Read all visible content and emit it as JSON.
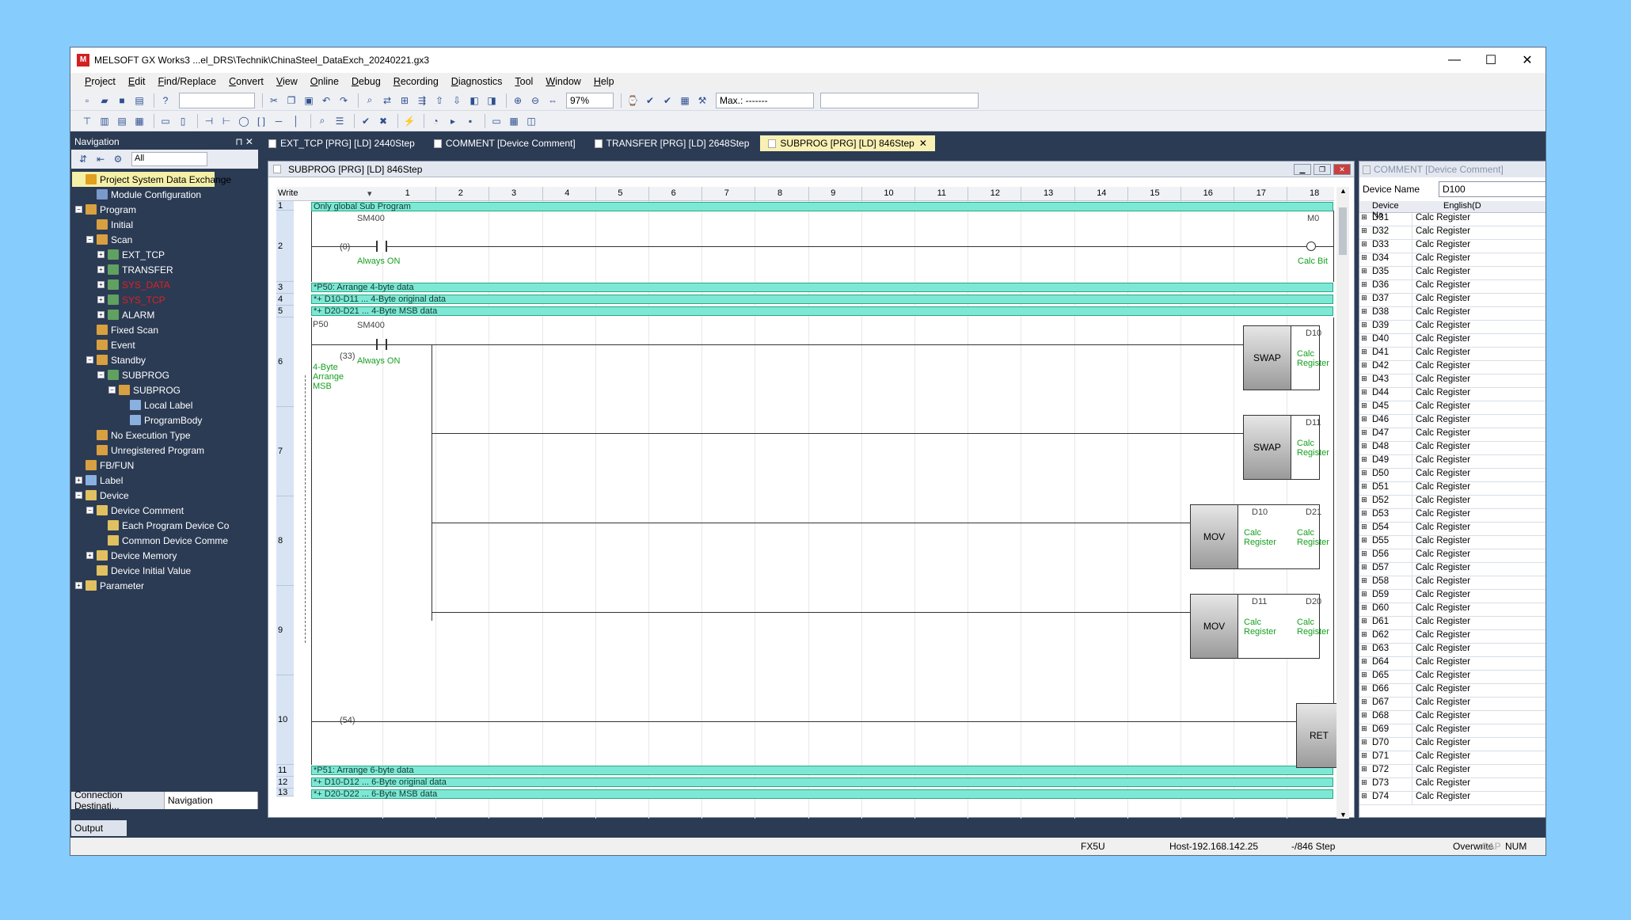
{
  "window": {
    "title": "MELSOFT GX Works3 ...el_DRS\\Technik\\ChinaSteel_DataExch_20240221.gx3",
    "min": "—",
    "max": "☐",
    "close": "✕"
  },
  "menu": [
    "Project",
    "Edit",
    "Find/Replace",
    "Convert",
    "View",
    "Online",
    "Debug",
    "Recording",
    "Diagnostics",
    "Tool",
    "Window",
    "Help"
  ],
  "toolbar": {
    "zoom": "97%",
    "max_label": "Max.: -------"
  },
  "nav": {
    "title": "Navigation",
    "filter": "All",
    "tree": [
      {
        "label": "Project System Data Exchange",
        "level": 0,
        "exp": "",
        "icon": "prj",
        "sel": true
      },
      {
        "label": "Module Configuration",
        "level": 1,
        "exp": "none",
        "icon": "mod"
      },
      {
        "label": "Program",
        "level": 0,
        "exp": "−",
        "icon": "prog"
      },
      {
        "label": "Initial",
        "level": 1,
        "exp": "none",
        "icon": "prog"
      },
      {
        "label": "Scan",
        "level": 1,
        "exp": "−",
        "icon": "prog"
      },
      {
        "label": "EXT_TCP",
        "level": 2,
        "exp": "+",
        "icon": "sheet"
      },
      {
        "label": "TRANSFER",
        "level": 2,
        "exp": "+",
        "icon": "sheet"
      },
      {
        "label": "SYS_DATA",
        "level": 2,
        "exp": "+",
        "icon": "sheet",
        "red": true
      },
      {
        "label": "SYS_TCP",
        "level": 2,
        "exp": "+",
        "icon": "sheet",
        "red": true
      },
      {
        "label": "ALARM",
        "level": 2,
        "exp": "+",
        "icon": "sheet"
      },
      {
        "label": "Fixed Scan",
        "level": 1,
        "exp": "none",
        "icon": "prog"
      },
      {
        "label": "Event",
        "level": 1,
        "exp": "none",
        "icon": "prog"
      },
      {
        "label": "Standby",
        "level": 1,
        "exp": "−",
        "icon": "prog"
      },
      {
        "label": "SUBPROG",
        "level": 2,
        "exp": "−",
        "icon": "sheet"
      },
      {
        "label": "SUBPROG",
        "level": 3,
        "exp": "−",
        "icon": "prog"
      },
      {
        "label": "Local Label",
        "level": 4,
        "exp": "none",
        "icon": "lbl"
      },
      {
        "label": "ProgramBody",
        "level": 4,
        "exp": "none",
        "icon": "lbl"
      },
      {
        "label": "No Execution Type",
        "level": 1,
        "exp": "none",
        "icon": "prog"
      },
      {
        "label": "Unregistered Program",
        "level": 1,
        "exp": "none",
        "icon": "prog"
      },
      {
        "label": "FB/FUN",
        "level": 0,
        "exp": "none",
        "icon": "prog"
      },
      {
        "label": "Label",
        "level": 0,
        "exp": "+",
        "icon": "lbl"
      },
      {
        "label": "Device",
        "level": 0,
        "exp": "−",
        "icon": "dev"
      },
      {
        "label": "Device Comment",
        "level": 1,
        "exp": "−",
        "icon": "dev"
      },
      {
        "label": "Each Program Device Co",
        "level": 2,
        "exp": "none",
        "icon": "dev"
      },
      {
        "label": "Common Device Comme",
        "level": 2,
        "exp": "none",
        "icon": "dev"
      },
      {
        "label": "Device Memory",
        "level": 1,
        "exp": "+",
        "icon": "dev"
      },
      {
        "label": "Device Initial Value",
        "level": 1,
        "exp": "none",
        "icon": "dev"
      },
      {
        "label": "Parameter",
        "level": 0,
        "exp": "+",
        "icon": "dev"
      }
    ],
    "bottom_tabs": [
      "Connection Destinati...",
      "Navigation"
    ]
  },
  "output_label": "Output",
  "tabs": [
    {
      "label": "EXT_TCP [PRG] [LD] 2440Step",
      "active": false
    },
    {
      "label": "COMMENT [Device Comment]",
      "active": false
    },
    {
      "label": "TRANSFER [PRG] [LD] 2648Step",
      "active": false
    },
    {
      "label": "SUBPROG [PRG] [LD] 846Step",
      "active": true,
      "close": "✕"
    }
  ],
  "editor": {
    "title": "SUBPROG [PRG] [LD] 846Step",
    "mode": "Write",
    "cols": [
      "1",
      "2",
      "3",
      "4",
      "5",
      "6",
      "7",
      "8",
      "9",
      "10",
      "11",
      "12",
      "13",
      "14",
      "15",
      "16",
      "17",
      "18"
    ],
    "rows": [
      "1",
      "2",
      "3",
      "4",
      "5",
      "6",
      "7",
      "8",
      "9",
      "10",
      "11",
      "12",
      "13"
    ],
    "comments": [
      "Only global Sub Program",
      "*P50: Arrange 4-byte data",
      "*+ D10-D11 ... 4-Byte original data",
      "*+ D20-D21 ... 4-Byte MSB data",
      "*P51: Arrange 6-byte data",
      "*+ D10-D12 ... 6-Byte original data",
      "*+ D20-D22 ... 6-Byte MSB data"
    ],
    "steps": [
      "(0)",
      "(33)",
      "(54)"
    ],
    "pointer": "P50",
    "pointer_comment": "4-Byte Arrange MSB",
    "sm400": "SM400",
    "always_on": "Always ON",
    "m0": "M0",
    "calc_bit": "Calc Bit",
    "calc_register": "Calc Register",
    "swap": "SWAP",
    "mov": "MOV",
    "ret": "RET",
    "d10": "D10",
    "d11": "D11",
    "d20": "D20",
    "d21": "D21"
  },
  "comment_panel": {
    "title": "COMMENT [Device Comment]",
    "device_name_label": "Device Name",
    "device_name_value": "D100",
    "headers": [
      "Device Na",
      "English(D"
    ],
    "rows": [
      {
        "d": "D31",
        "e": "Calc Register"
      },
      {
        "d": "D32",
        "e": "Calc Register"
      },
      {
        "d": "D33",
        "e": "Calc Register"
      },
      {
        "d": "D34",
        "e": "Calc Register"
      },
      {
        "d": "D35",
        "e": "Calc Register"
      },
      {
        "d": "D36",
        "e": "Calc Register"
      },
      {
        "d": "D37",
        "e": "Calc Register"
      },
      {
        "d": "D38",
        "e": "Calc Register"
      },
      {
        "d": "D39",
        "e": "Calc Register"
      },
      {
        "d": "D40",
        "e": "Calc Register"
      },
      {
        "d": "D41",
        "e": "Calc Register"
      },
      {
        "d": "D42",
        "e": "Calc Register"
      },
      {
        "d": "D43",
        "e": "Calc Register"
      },
      {
        "d": "D44",
        "e": "Calc Register"
      },
      {
        "d": "D45",
        "e": "Calc Register"
      },
      {
        "d": "D46",
        "e": "Calc Register"
      },
      {
        "d": "D47",
        "e": "Calc Register"
      },
      {
        "d": "D48",
        "e": "Calc Register"
      },
      {
        "d": "D49",
        "e": "Calc Register"
      },
      {
        "d": "D50",
        "e": "Calc Register"
      },
      {
        "d": "D51",
        "e": "Calc Register"
      },
      {
        "d": "D52",
        "e": "Calc Register"
      },
      {
        "d": "D53",
        "e": "Calc Register"
      },
      {
        "d": "D54",
        "e": "Calc Register"
      },
      {
        "d": "D55",
        "e": "Calc Register"
      },
      {
        "d": "D56",
        "e": "Calc Register"
      },
      {
        "d": "D57",
        "e": "Calc Register"
      },
      {
        "d": "D58",
        "e": "Calc Register"
      },
      {
        "d": "D59",
        "e": "Calc Register"
      },
      {
        "d": "D60",
        "e": "Calc Register"
      },
      {
        "d": "D61",
        "e": "Calc Register"
      },
      {
        "d": "D62",
        "e": "Calc Register"
      },
      {
        "d": "D63",
        "e": "Calc Register"
      },
      {
        "d": "D64",
        "e": "Calc Register"
      },
      {
        "d": "D65",
        "e": "Calc Register"
      },
      {
        "d": "D66",
        "e": "Calc Register"
      },
      {
        "d": "D67",
        "e": "Calc Register"
      },
      {
        "d": "D68",
        "e": "Calc Register"
      },
      {
        "d": "D69",
        "e": "Calc Register"
      },
      {
        "d": "D70",
        "e": "Calc Register"
      },
      {
        "d": "D71",
        "e": "Calc Register"
      },
      {
        "d": "D72",
        "e": "Calc Register"
      },
      {
        "d": "D73",
        "e": "Calc Register"
      },
      {
        "d": "D74",
        "e": "Calc Register"
      }
    ]
  },
  "status": {
    "cpu": "FX5U",
    "host": "Host-192.168.142.25",
    "step": "-/846 Step",
    "overwrite": "Overwrite",
    "cap": "CAP",
    "num": "NUM"
  }
}
